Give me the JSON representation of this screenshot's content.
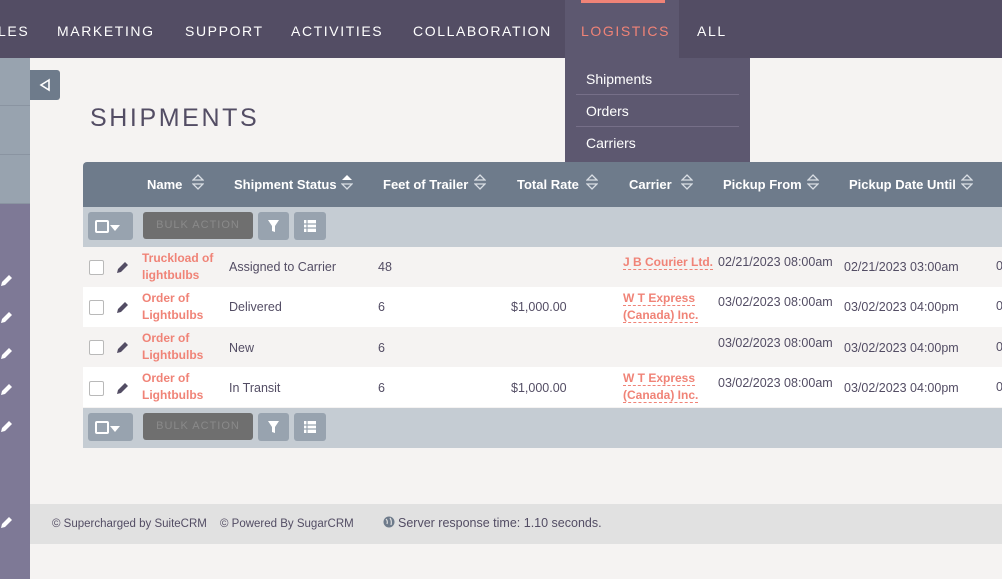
{
  "nav": {
    "items": [
      {
        "label": "LES"
      },
      {
        "label": "MARKETING"
      },
      {
        "label": "SUPPORT"
      },
      {
        "label": "ACTIVITIES"
      },
      {
        "label": "COLLABORATION"
      },
      {
        "label": "LOGISTICS",
        "active": true
      },
      {
        "label": "ALL"
      }
    ],
    "dropdown": [
      "Shipments",
      "Orders",
      "Carriers"
    ]
  },
  "sidebar": {
    "collapse_icon": "triangle-left-icon"
  },
  "page": {
    "title": "SHIPMENTS"
  },
  "table": {
    "columns": [
      "Name",
      "Shipment Status",
      "Feet of Trailer",
      "Total Rate",
      "Carrier",
      "Pickup From",
      "Pickup Date Until"
    ],
    "sorted_column": "Shipment Status",
    "bulk_action_label": "BULK ACTION",
    "rows": [
      {
        "name": "Truckload of lightbulbs",
        "status": "Assigned to Carrier",
        "feet": "48",
        "rate": "",
        "carrier": "J B Courier Ltd.",
        "pickup_from": "02/21/2023 08:00am",
        "pickup_until": "02/21/2023 03:00am",
        "cut": "0"
      },
      {
        "name": "Order of Lightbulbs",
        "status": "Delivered",
        "feet": "6",
        "rate": "$1,000.00",
        "carrier": "W T Express (Canada) Inc.",
        "pickup_from": "03/02/2023 08:00am",
        "pickup_until": "03/02/2023 04:00pm",
        "cut": "0"
      },
      {
        "name": "Order of Lightbulbs",
        "status": "New",
        "feet": "6",
        "rate": "",
        "carrier": "",
        "pickup_from": "03/02/2023 08:00am",
        "pickup_until": "03/02/2023 04:00pm",
        "cut": "0"
      },
      {
        "name": "Order of Lightbulbs",
        "status": "In Transit",
        "feet": "6",
        "rate": "$1,000.00",
        "carrier": "W T Express (Canada) Inc.",
        "pickup_from": "03/02/2023 08:00am",
        "pickup_until": "03/02/2023 04:00pm",
        "cut": "0"
      }
    ]
  },
  "footer": {
    "supercharged": "© Supercharged by SuiteCRM",
    "powered": "© Powered By SugarCRM",
    "server": "Server response time: 1.10 seconds."
  },
  "colors": {
    "nav_bg": "#534d64",
    "accent": "#f08377",
    "table_header": "#6e7b8b",
    "action_bar": "#c5ccd3"
  }
}
